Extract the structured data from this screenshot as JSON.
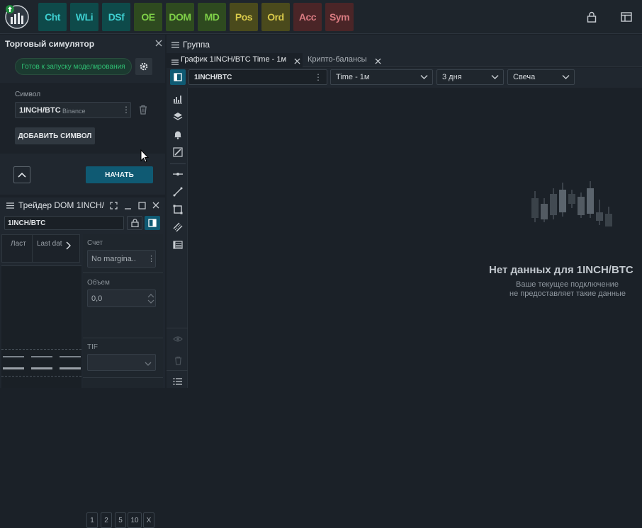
{
  "topbar": {
    "buttons": [
      {
        "label": "Cht",
        "bg": "#0e4a4a",
        "fg": "#3ecfd0"
      },
      {
        "label": "WLi",
        "bg": "#0e4a4a",
        "fg": "#3ecfd0"
      },
      {
        "label": "DSf",
        "bg": "#0e4a4a",
        "fg": "#3ecfd0"
      },
      {
        "label": "OE",
        "bg": "#2e4a1f",
        "fg": "#7fd048"
      },
      {
        "label": "DOM",
        "bg": "#2e4a1f",
        "fg": "#7fd048"
      },
      {
        "label": "MD",
        "bg": "#2e4a1f",
        "fg": "#7fd048"
      },
      {
        "label": "Pos",
        "bg": "#4a4a1c",
        "fg": "#d8c94a"
      },
      {
        "label": "Ord",
        "bg": "#4a4a1c",
        "fg": "#d8c94a"
      },
      {
        "label": "Acc",
        "bg": "#4a2527",
        "fg": "#d87a80"
      },
      {
        "label": "Sym",
        "bg": "#4a2527",
        "fg": "#d87a80"
      }
    ]
  },
  "simulator": {
    "title": "Торговый симулятор",
    "status": "Готов к запуску моделирования",
    "symbol_label": "Символ",
    "symbol": "1INCH/BTC",
    "exchange": "Binance",
    "add_symbol": "ДОБАВИТЬ СИМВОЛ",
    "start": "НАЧАТЬ"
  },
  "dom": {
    "title": "Трейдер DOM 1INCH/",
    "symbol": "1INCH/BTC",
    "col_last": "Ласт",
    "col_last_date": "Last dat",
    "account_label": "Счет",
    "account_value": "No margina..",
    "volume_label": "Объем",
    "volume_value": "0,0",
    "qty_buttons": [
      "1",
      "2",
      "5",
      "10",
      "X"
    ],
    "tif_label": "TIF"
  },
  "group": {
    "title": "Группа",
    "tabs": [
      {
        "label": "График 1INCH/BTC Time - 1м"
      },
      {
        "label": "Крипто-балансы"
      }
    ]
  },
  "chart": {
    "symbol": "1INCH/BTC",
    "timeframe": "Time - 1м",
    "period": "3 дня",
    "style": "Свеча",
    "no_data_title": "Нет данных для 1INCH/BTC",
    "no_data_line1": "Ваше текущее подключение",
    "no_data_line2": "не предоставляет такие данные"
  }
}
